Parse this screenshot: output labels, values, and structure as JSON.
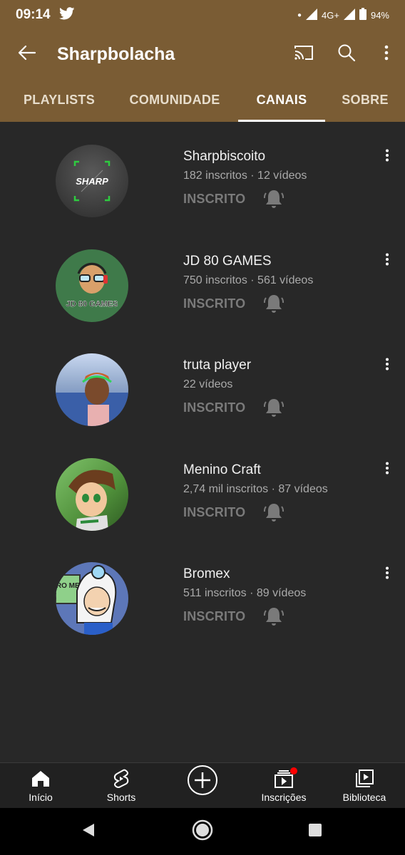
{
  "status_bar": {
    "time": "09:14",
    "network": "4G+",
    "battery": "94%"
  },
  "app_bar": {
    "title": "Sharpbolacha",
    "icons": [
      "back-arrow-icon",
      "cast-icon",
      "search-icon",
      "more-vert-icon"
    ]
  },
  "tabs": [
    {
      "label": "PLAYLISTS",
      "active": false
    },
    {
      "label": "COMUNIDADE",
      "active": false
    },
    {
      "label": "CANAIS",
      "active": true
    },
    {
      "label": "SOBRE",
      "active": false
    }
  ],
  "channels": [
    {
      "name": "Sharpbiscoito",
      "meta": "182 inscritos · 12 vídeos",
      "subscribed_label": "INSCRITO",
      "avatar_text": "SHARP"
    },
    {
      "name": "JD 80 GAMES",
      "meta": "750 inscritos · 561 vídeos",
      "subscribed_label": "INSCRITO",
      "avatar_text": "JD 80 GAMES"
    },
    {
      "name": "truta player",
      "meta": "22 vídeos",
      "subscribed_label": "INSCRITO"
    },
    {
      "name": "Menino Craft",
      "meta": "2,74 mil inscritos · 87 vídeos",
      "subscribed_label": "INSCRITO"
    },
    {
      "name": "Bromex",
      "meta": "511 inscritos · 89 vídeos",
      "subscribed_label": "INSCRITO",
      "avatar_text": "BRO MEX"
    }
  ],
  "bottom_nav": [
    {
      "label": "Início",
      "icon": "home-icon"
    },
    {
      "label": "Shorts",
      "icon": "shorts-icon"
    },
    {
      "label": "",
      "icon": "create-plus-icon"
    },
    {
      "label": "Inscrições",
      "icon": "subscriptions-icon",
      "badge": true
    },
    {
      "label": "Biblioteca",
      "icon": "library-icon"
    }
  ],
  "colors": {
    "header_brown": "#7a5c34",
    "background": "#282828",
    "notification_red": "#ff0000"
  }
}
